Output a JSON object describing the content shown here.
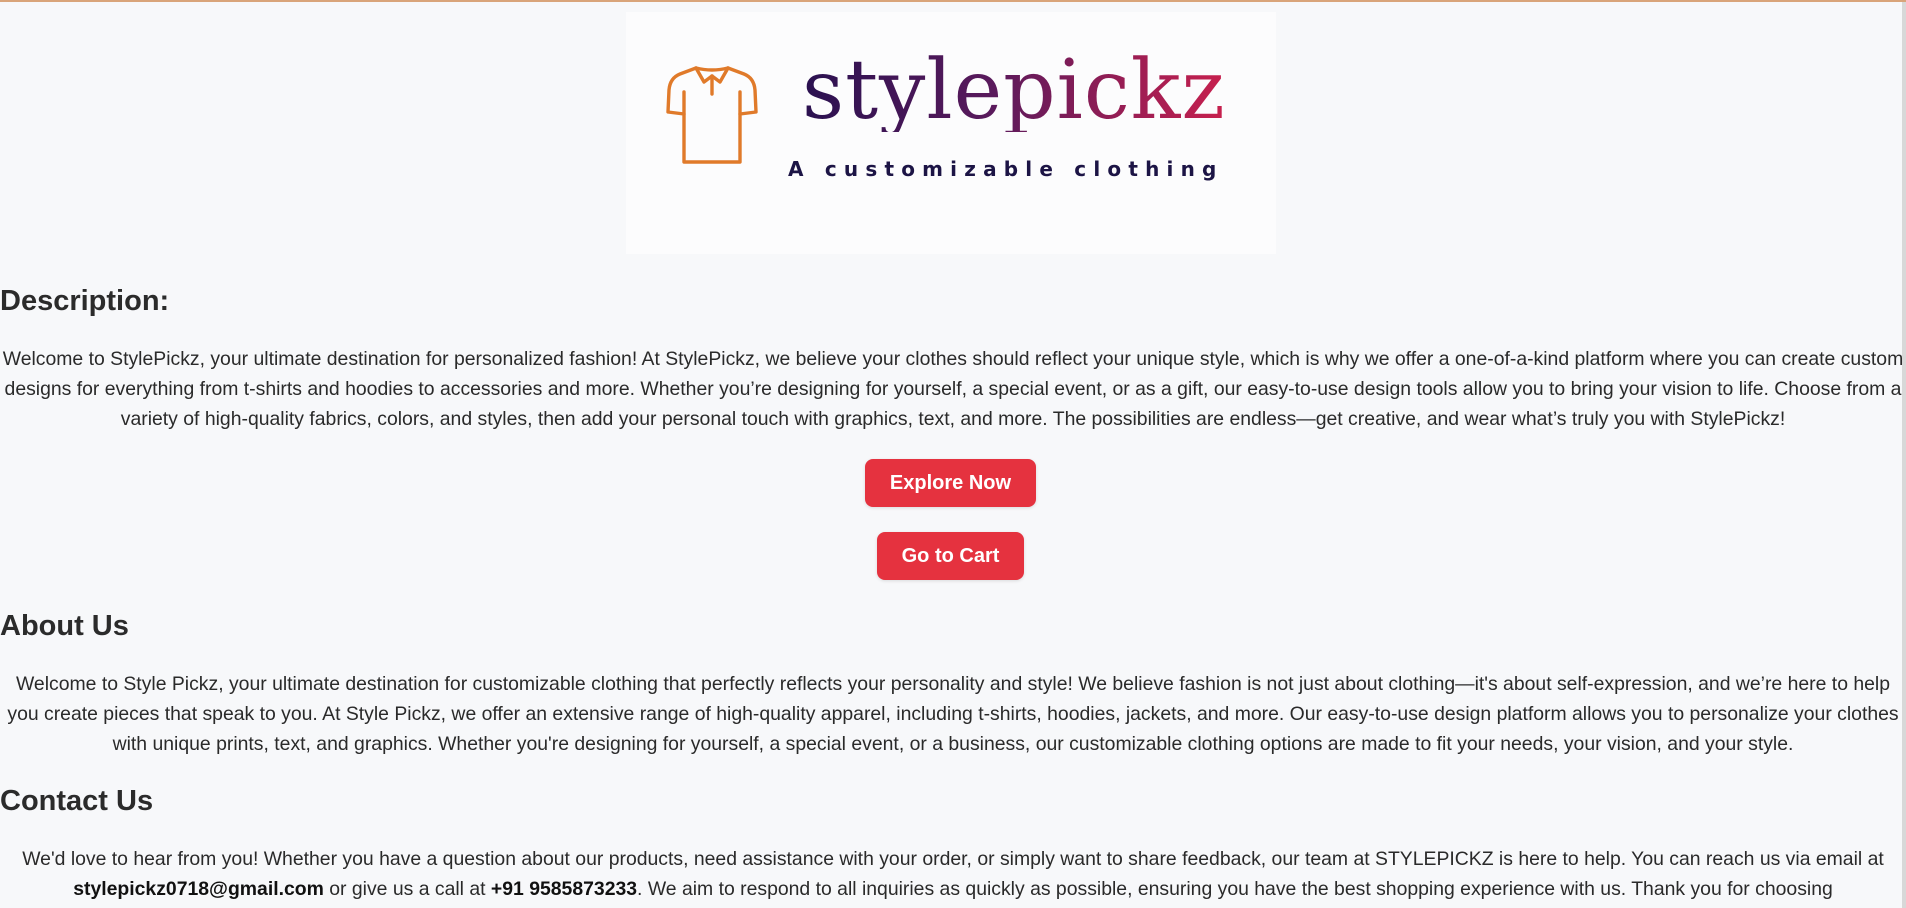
{
  "logo": {
    "brand": "stylepickz",
    "tagline": "A customizable clothing",
    "icon": "tshirt-icon",
    "colors": {
      "icon": "#e07a2a",
      "gradient_start": "#2a1150",
      "gradient_end": "#c8204e",
      "tagline": "#1c1445"
    }
  },
  "description": {
    "title": "Description:",
    "text": "Welcome to StylePickz, your ultimate destination for personalized fashion! At StylePickz, we believe your clothes should reflect your unique style, which is why we offer a one-of-a-kind platform where you can create custom designs for everything from t-shirts and hoodies to accessories and more. Whether you’re designing for yourself, a special event, or as a gift, our easy-to-use design tools allow you to bring your vision to life. Choose from a variety of high-quality fabrics, colors, and styles, then add your personal touch with graphics, text, and more. The possibilities are endless—get creative, and wear what’s truly you with StylePickz!"
  },
  "buttons": {
    "explore": "Explore Now",
    "cart": "Go to Cart",
    "color": "#e5323f"
  },
  "about": {
    "title": "About Us",
    "text": "Welcome to Style Pickz, your ultimate destination for customizable clothing that perfectly reflects your personality and style! We believe fashion is not just about clothing—it's about self-expression, and we’re here to help you create pieces that speak to you. At Style Pickz, we offer an extensive range of high-quality apparel, including t-shirts, hoodies, jackets, and more. Our easy-to-use design platform allows you to personalize your clothes with unique prints, text, and graphics. Whether you're designing for yourself, a special event, or a business, our customizable clothing options are made to fit your needs, your vision, and your style."
  },
  "contact": {
    "title": "Contact Us",
    "text_before_email": "We'd love to hear from you! Whether you have a question about our products, need assistance with your order, or simply want to share feedback, our team at STYLEPICKZ is here to help. You can reach us via email at ",
    "email": "stylepickz0718@gmail.com",
    "text_before_phone": " or give us a call at ",
    "phone": "+91 9585873233",
    "text_after_phone": ". We aim to respond to all inquiries as quickly as possible, ensuring you have the best shopping experience with us. Thank you for choosing"
  }
}
